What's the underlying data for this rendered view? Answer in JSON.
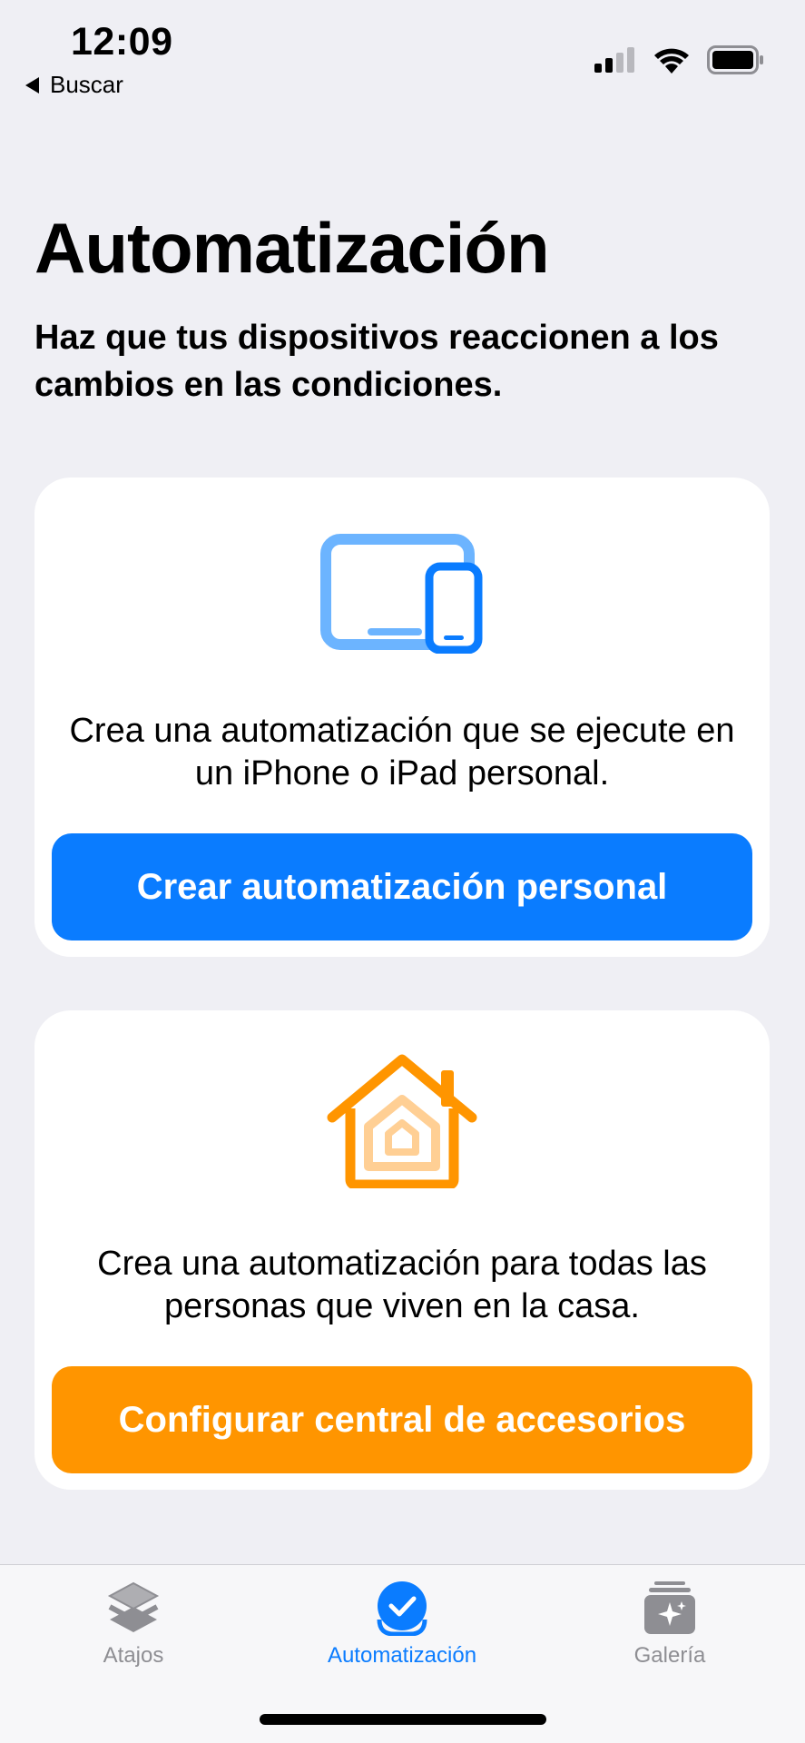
{
  "status_bar": {
    "time": "12:09",
    "back_label": "Buscar"
  },
  "header": {
    "title": "Automatización",
    "subtitle": "Haz que tus dispositivos reaccionen a los cambios en las condiciones."
  },
  "cards": [
    {
      "icon": "devices-icon",
      "description": "Crea una automatización que se ejecute en un iPhone o iPad personal.",
      "button_label": "Crear automatización personal",
      "accent": "#0a7cff"
    },
    {
      "icon": "home-icon",
      "description": "Crea una automatización para todas las personas que viven en la casa.",
      "button_label": "Configurar central de accesorios",
      "accent": "#ff9500"
    }
  ],
  "tab_bar": {
    "tabs": [
      {
        "label": "Atajos",
        "icon": "layers-icon",
        "selected": false
      },
      {
        "label": "Automatización",
        "icon": "checkmark-circle-icon",
        "selected": true
      },
      {
        "label": "Galería",
        "icon": "gallery-icon",
        "selected": false
      }
    ]
  },
  "colors": {
    "background": "#efeff4",
    "blue": "#0a7cff",
    "orange": "#ff9500",
    "inactive_tab": "#8e8e93"
  }
}
